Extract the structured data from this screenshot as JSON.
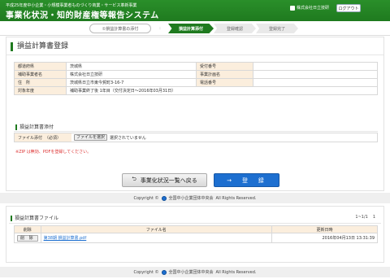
{
  "header": {
    "subtitle": "平成25年度中小企業・小規模事業者ものづくり商業・サービス革新事業",
    "title": "事業化状況・知的財産権等報告システム",
    "user_name": "株式会社日立技研",
    "logout_label": "ログアウト"
  },
  "steps": [
    {
      "label": "①損益計算書の添付"
    },
    {
      "label": ":"
    },
    {
      "label": "損益計算添付"
    },
    {
      "label": "登録確認"
    },
    {
      "label": "登録完了"
    }
  ],
  "page_title": "損益計算書登録",
  "info_rows": [
    {
      "l1": "都道府県",
      "v1": "茨城県",
      "l2": "受付番号",
      "v2": ""
    },
    {
      "l1": "補助事業者名",
      "v1": "株式会社日立技研",
      "l2": "事業計画名",
      "v2": ""
    },
    {
      "l1": "住　所",
      "v1": "茨城県日立市東今賀町3-16-7",
      "l2": "電話番号",
      "v2": ""
    },
    {
      "l1": "対象年度",
      "v1": "補助事業終了後 1年目（交付決定日～2016年03月31日）"
    }
  ],
  "attach": {
    "section_title": "損益計算書添付",
    "label": "ファイル添付",
    "required": "（必須）",
    "button_label": "ファイルを選択",
    "status": "選択されていません",
    "notice": "※ZIP は無効、PDFを登録してください。"
  },
  "buttons": {
    "back_label": "事業化状況一覧へ戻る",
    "register_label": "登　録"
  },
  "footer": {
    "copyright": "Copyright ©",
    "org": "全国中小企業団体中央会",
    "rights": "All Rights Reserved."
  },
  "file_list": {
    "section_title": "損益計算書ファイル",
    "pager": "1~1/1",
    "pager_page": "1",
    "columns": [
      "削除",
      "ファイル名",
      "更新日時"
    ],
    "rows": [
      {
        "delete_label": "削 除",
        "file_name": "第38期 損益計算書.pdf",
        "updated": "2016年04月13日 13:31:39"
      }
    ]
  },
  "colors": {
    "brand_green": "#1f7a1f",
    "label_bg": "#fbeedd",
    "primary_blue": "#1d6fd0"
  }
}
